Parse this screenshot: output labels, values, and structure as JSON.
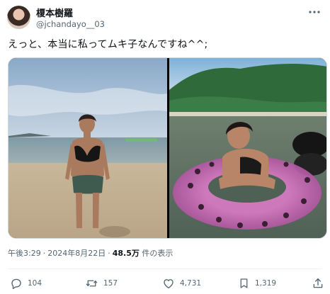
{
  "author": {
    "display_name": "榎本樹羅",
    "handle": "@jchandayo__03",
    "avatar_icon": "profile-avatar"
  },
  "tweet": {
    "text": "えっと、本当に私ってムキ子なんですね^^;"
  },
  "media": {
    "count": 2,
    "items": [
      "beach-photo",
      "swim-ring-photo"
    ]
  },
  "meta": {
    "time": "午後3:29",
    "separator": "·",
    "date": "2024年8月22日",
    "views_count": "48.5万",
    "views_label": "件の表示"
  },
  "actions": {
    "reply_count": "104",
    "retweet_count": "157",
    "like_count": "4,731",
    "bookmark_count": "1,319"
  },
  "icons": {
    "more": "more-icon",
    "reply": "reply-icon",
    "retweet": "retweet-icon",
    "like": "heart-icon",
    "bookmark": "bookmark-icon",
    "share": "share-icon"
  },
  "colors": {
    "text": "#0f1419",
    "secondary": "#536471",
    "border": "#cfd9de"
  }
}
